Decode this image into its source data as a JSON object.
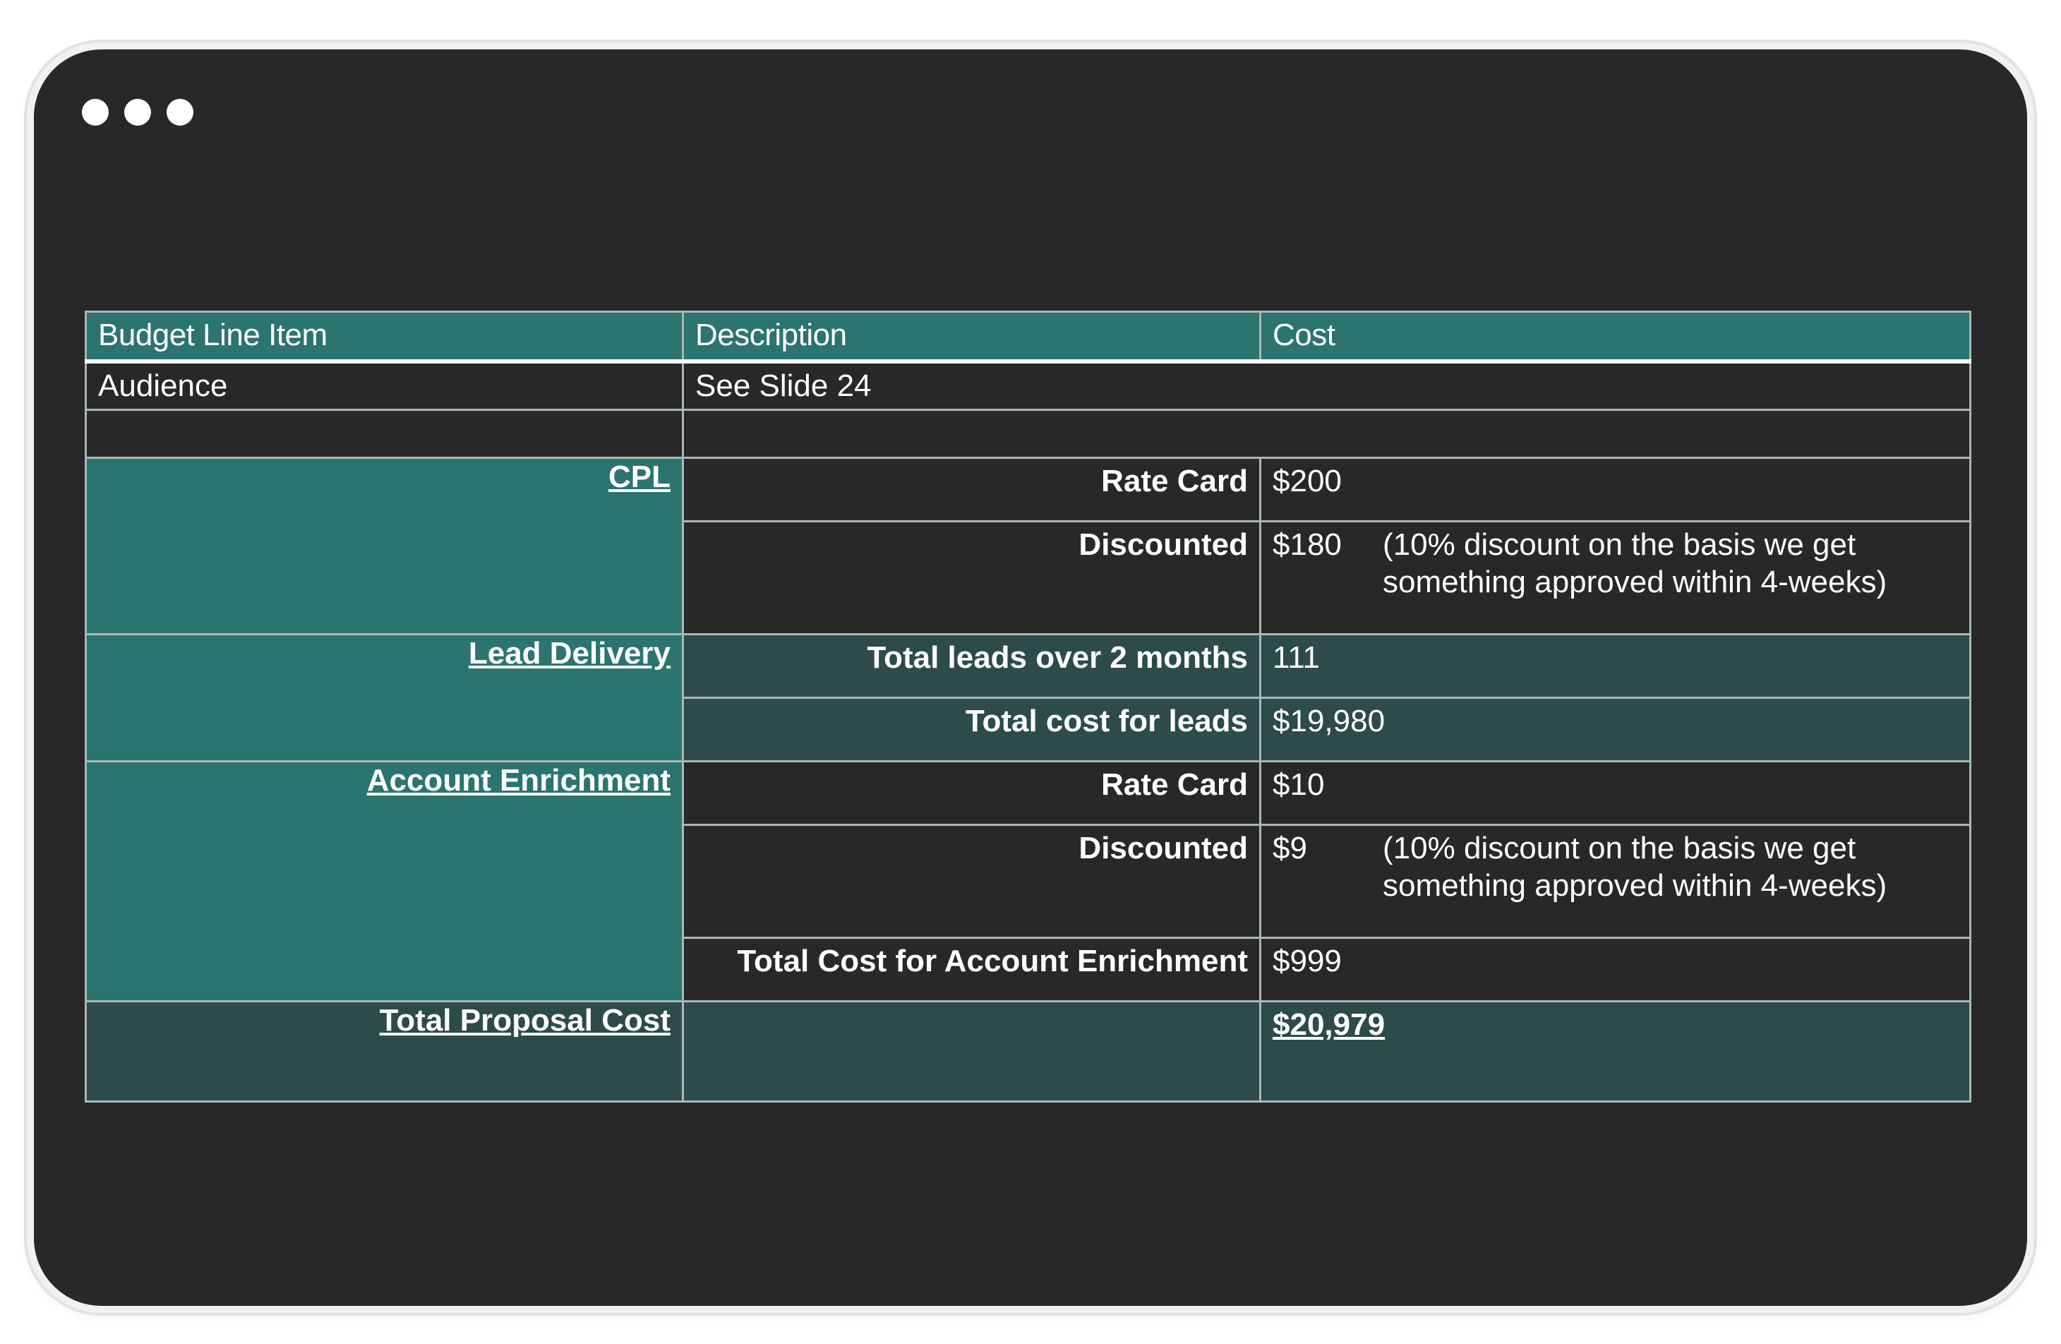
{
  "table": {
    "headers": {
      "item": "Budget Line Item",
      "description": "Description",
      "cost": "Cost"
    },
    "audience": {
      "label": "Audience",
      "description": "See Slide 24"
    },
    "cpl": {
      "label": "CPL",
      "rate_card_label": "Rate Card",
      "rate_card_value": "$200",
      "discounted_label": "Discounted",
      "discounted_value": "$180",
      "discount_note": "(10% discount on the basis we get something approved within 4-weeks)"
    },
    "lead_delivery": {
      "label": "Lead Delivery",
      "total_leads_label": "Total leads over 2 months",
      "total_leads_value": "111",
      "total_cost_label": "Total cost for leads",
      "total_cost_value": "$19,980"
    },
    "account_enrichment": {
      "label": "Account Enrichment",
      "rate_card_label": "Rate Card",
      "rate_card_value": "$10",
      "discounted_label": "Discounted",
      "discounted_value": "$9",
      "discount_note": "(10% discount on the basis we get something approved within 4-weeks)",
      "total_label": "Total Cost for Account Enrichment",
      "total_value": "$999"
    },
    "total": {
      "label": "Total Proposal Cost",
      "value": "$20,979"
    }
  },
  "colors": {
    "window_bg": "#282828",
    "teal": "#2b7470",
    "slate": "#2c4b4a",
    "border": "#a9b9b5"
  }
}
